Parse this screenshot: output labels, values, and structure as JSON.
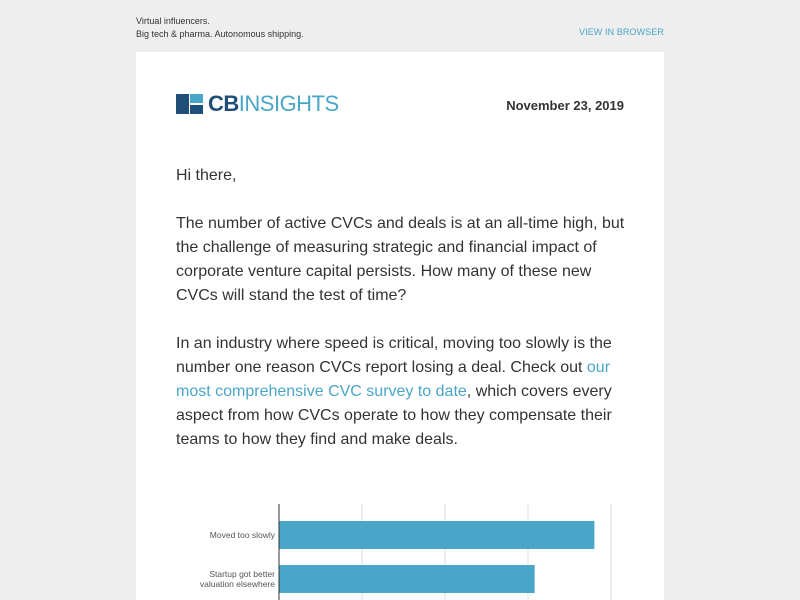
{
  "preheader": {
    "line1": "Virtual influencers.",
    "line2": "Big tech & pharma. Autonomous shipping."
  },
  "view_in_browser": "VIEW IN BROWSER",
  "logo": {
    "icon": "cb-insights-logo-icon",
    "text_bold": "CB",
    "text_light": "INSIGHTS",
    "colors": {
      "navy": "#1f4e79",
      "light_blue": "#4aa6c8"
    }
  },
  "date": "November 23, 2019",
  "body": {
    "greeting": "Hi there,",
    "paragraph1": "The number of active CVCs and deals is at an all-time high, but the challenge of measuring strategic and financial impact of corporate venture capital persists. How many of these new CVCs will stand the test of time?",
    "paragraph2_before": "In an industry where speed is critical, moving too slowly is the number one reason CVCs report losing a deal. Check out ",
    "paragraph2_link": "our most comprehensive CVC survey to date",
    "paragraph2_after": ", which covers every aspect from how CVCs operate to how they compensate their teams to how they find and make deals."
  },
  "colors": {
    "link": "#4aa6c8",
    "bar": "#4aa6c8",
    "text": "#333333"
  },
  "chart_data": {
    "type": "bar",
    "orientation": "horizontal",
    "categories": [
      "Moved too slowly",
      "Startup got better valuation elsewhere"
    ],
    "values": [
      95,
      77
    ],
    "xlim": [
      0,
      100
    ],
    "grid": true,
    "title": "",
    "xlabel": "",
    "ylabel": ""
  }
}
